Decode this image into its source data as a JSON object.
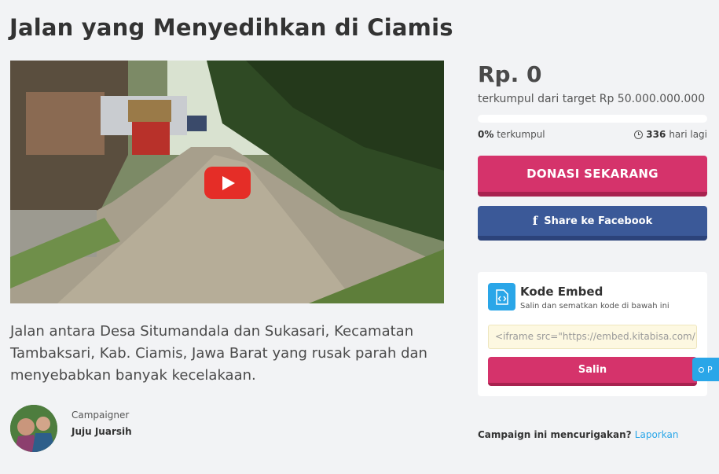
{
  "campaign": {
    "title": "Jalan yang Menyedihkan di Ciamis",
    "description": "Jalan antara Desa Situmandala dan Sukasari, Kecamatan Tambaksari, Kab. Ciamis, Jawa Barat yang rusak parah dan menyebabkan banyak kecelakaan."
  },
  "campaigner": {
    "label": "Campaigner",
    "name": "Juju Juarsih"
  },
  "funding": {
    "amount": "Rp. 0",
    "target_text": "terkumpul dari target Rp 50.000.000.000",
    "progress_fraction": 0,
    "percent": "0%",
    "percent_suffix": " terkumpul",
    "days": "336",
    "days_suffix": " hari lagi"
  },
  "actions": {
    "donate_label": "DONASI SEKARANG",
    "facebook_label": "Share ke Facebook"
  },
  "embed": {
    "title": "Kode Embed",
    "subtitle": "Salin dan sematkan kode di bawah ini",
    "code_value": "<iframe src=\"https://embed.kitabisa.com/",
    "copy_label": "Salin"
  },
  "floating_tab": {
    "label": "P"
  },
  "report": {
    "question": "Campaign ini mencurigakan? ",
    "link_label": "Laporkan"
  },
  "colors": {
    "primary": "#d5336b",
    "facebook": "#3b5998",
    "accent": "#2aa6e8"
  },
  "icons": [
    "youtube-play-icon",
    "clock-icon",
    "facebook-icon",
    "code-embed-icon"
  ]
}
